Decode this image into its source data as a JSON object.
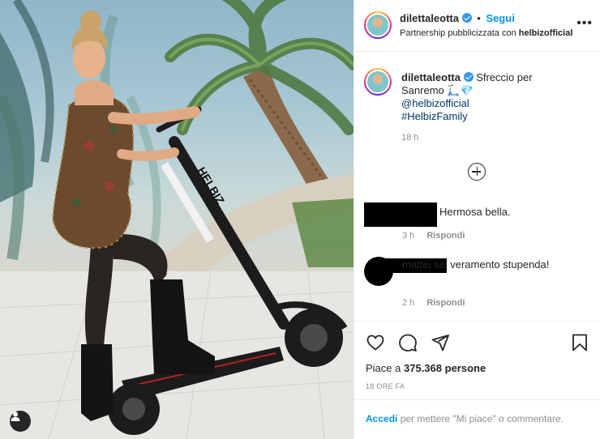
{
  "post_image": {
    "scooter_brand_text": "HELBIZ"
  },
  "header": {
    "username": "dilettaleotta",
    "follow_label": "Segui",
    "separator": "•",
    "partnership_prefix": "Partnership pubblicizzata con",
    "partner": "helbizofficial",
    "more_label": "•••"
  },
  "caption": {
    "username": "dilettaleotta",
    "text": "Sfreccio per Sanremo 🛴💎",
    "mention": "@helbizofficial",
    "hashtag": "#HelbizFamily",
    "time": "18 h"
  },
  "comments": [
    {
      "text": "Hermosa bella.",
      "time": "3 h",
      "reply_label": "Rispondi"
    },
    {
      "text": "mattei sei veramento stupenda!",
      "time": "2 h",
      "reply_label": "Rispondi"
    }
  ],
  "actions": {
    "likes_prefix": "Piace a",
    "likes_count": "375.368",
    "likes_suffix": "persone",
    "post_date": "18 ORE FA"
  },
  "login_bar": {
    "login_label": "Accedi",
    "text": "per mettere \"Mi piace\" o commentare."
  },
  "icons": [
    "heart-icon",
    "comment-icon",
    "share-icon",
    "bookmark-icon",
    "add-circle-icon",
    "user-tag-icon",
    "verified-icon"
  ],
  "colors": {
    "link_blue": "#0095f6",
    "mention_blue": "#00376b",
    "muted_gray": "#8e8e8e",
    "border": "#efefef"
  }
}
